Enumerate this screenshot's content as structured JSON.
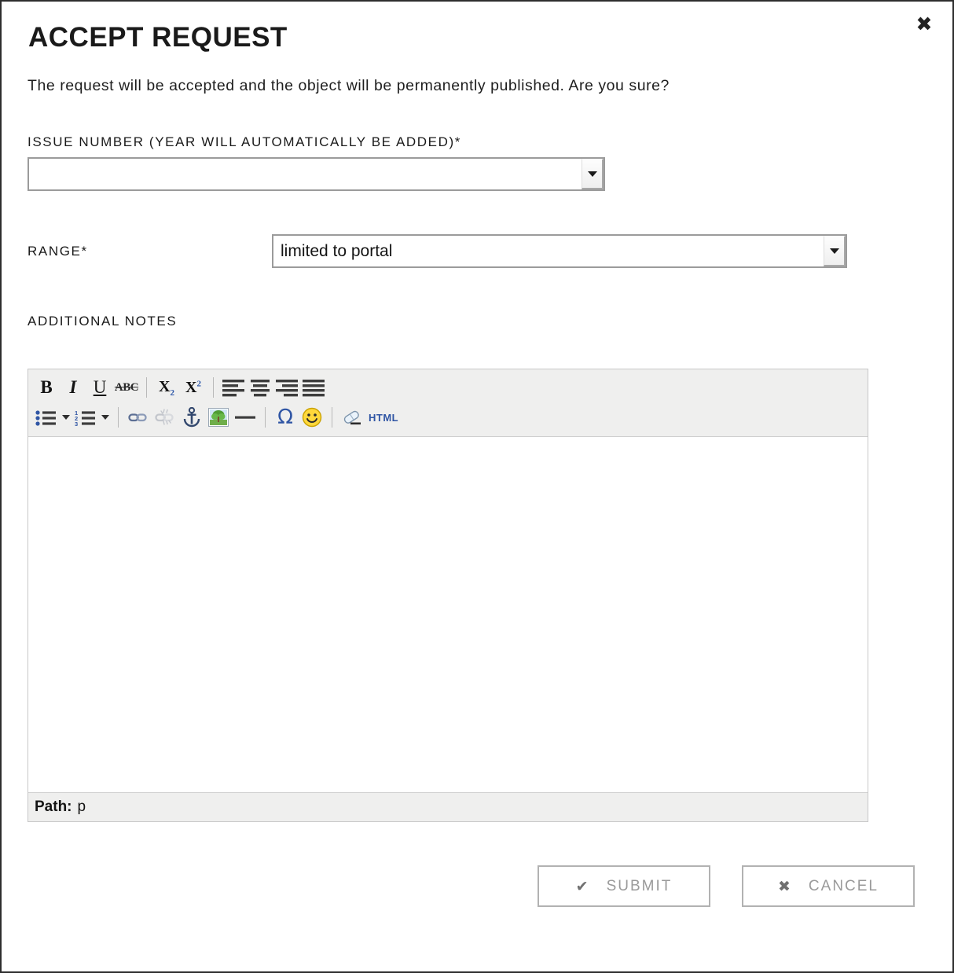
{
  "dialog": {
    "title": "ACCEPT REQUEST",
    "description": "The request will be accepted and the object will be permanently published. Are you sure?",
    "close_icon": "✖"
  },
  "form": {
    "issue": {
      "label": "ISSUE NUMBER (YEAR WILL AUTOMATICALLY BE ADDED)*",
      "value": "",
      "placeholder": ""
    },
    "range": {
      "label": "RANGE*",
      "value": "limited to portal"
    },
    "notes": {
      "label": "ADDITIONAL NOTES"
    }
  },
  "editor": {
    "toolbar_row1": [
      {
        "name": "bold-icon",
        "glyph": "B",
        "kind": "bold"
      },
      {
        "name": "italic-icon",
        "glyph": "I",
        "kind": "italic"
      },
      {
        "name": "underline-icon",
        "glyph": "U",
        "kind": "underline"
      },
      {
        "name": "strikethrough-icon",
        "glyph": "ABC",
        "kind": "strike"
      },
      {
        "name": "toolbar-separator",
        "kind": "sep"
      },
      {
        "name": "subscript-icon",
        "glyph": "X",
        "sub": "2",
        "kind": "sub"
      },
      {
        "name": "superscript-icon",
        "glyph": "X",
        "sup": "2",
        "kind": "sup"
      },
      {
        "name": "toolbar-separator",
        "kind": "sep"
      },
      {
        "name": "align-left-icon",
        "kind": "align-left"
      },
      {
        "name": "align-center-icon",
        "kind": "align-center"
      },
      {
        "name": "align-right-icon",
        "kind": "align-right"
      },
      {
        "name": "align-justify-icon",
        "kind": "align-justify"
      }
    ],
    "toolbar_row2": [
      {
        "name": "bullet-list-icon",
        "kind": "ul"
      },
      {
        "name": "bullet-list-dropdown-arrow",
        "kind": "arrow"
      },
      {
        "name": "numbered-list-icon",
        "kind": "ol"
      },
      {
        "name": "numbered-list-dropdown-arrow",
        "kind": "arrow"
      },
      {
        "name": "toolbar-separator",
        "kind": "sep"
      },
      {
        "name": "insert-link-icon",
        "kind": "link"
      },
      {
        "name": "unlink-icon",
        "kind": "unlink"
      },
      {
        "name": "anchor-icon",
        "kind": "anchor"
      },
      {
        "name": "insert-image-icon",
        "kind": "image"
      },
      {
        "name": "horizontal-rule-icon",
        "kind": "hr"
      },
      {
        "name": "toolbar-separator",
        "kind": "sep"
      },
      {
        "name": "special-character-icon",
        "glyph": "Ω",
        "kind": "omega"
      },
      {
        "name": "emoticon-icon",
        "kind": "smiley"
      },
      {
        "name": "toolbar-separator",
        "kind": "sep"
      },
      {
        "name": "cleanup-eraser-icon",
        "kind": "eraser"
      },
      {
        "name": "edit-html-icon",
        "glyph": "HTML",
        "kind": "html"
      }
    ],
    "content": "",
    "path_label": "Path:",
    "path_value": "p"
  },
  "footer": {
    "submit": {
      "label": "SUBMIT",
      "icon": "✔"
    },
    "cancel": {
      "label": "CANCEL",
      "icon": "✖"
    }
  },
  "colors": {
    "dialog_border": "#2e2e2e",
    "toolbar_bg": "#efefee",
    "accent_blue": "#2f55a4",
    "button_text": "#9a9a9a"
  }
}
